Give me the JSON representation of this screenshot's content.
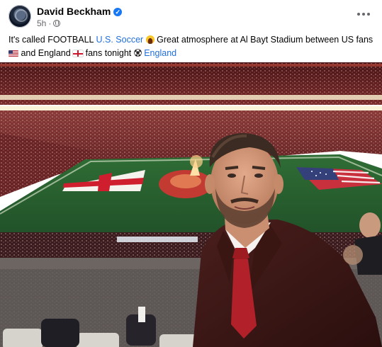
{
  "post": {
    "author": "David Beckham",
    "verified": true,
    "time": "5h",
    "privacy_icon": "globe-icon",
    "more_icon": "more-options-icon"
  },
  "caption": {
    "part1": "It's called FOOTBALL ",
    "link1": "U.S. Soccer",
    "part2": " Great atmosphere at Al Bayt Stadium between US fans ",
    "part3": " and England ",
    "part4": " fans tonight ",
    "link2": "England",
    "emoji": [
      "laughing-face",
      "us-flag",
      "england-flag",
      "soccer-ball"
    ]
  },
  "photo": {
    "subject": "stadium-selfie",
    "colors": {
      "pitch": "#2f6b33",
      "crowd": "#6e1f22",
      "stands": "#d0b8a0"
    }
  },
  "colors": {
    "link": "#216fdb",
    "text": "#050505",
    "muted": "#65676b",
    "verified": "#1877f2"
  }
}
